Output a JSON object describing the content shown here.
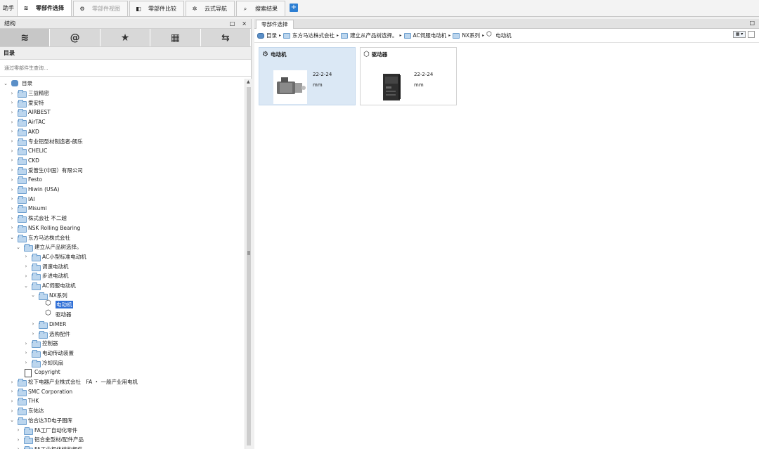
{
  "topbar": {
    "helper": "助手",
    "tabs": [
      {
        "label": "零部件选择",
        "icon": "database-icon",
        "active": true,
        "disabled": false
      },
      {
        "label": "零部件视图",
        "icon": "parts-view-icon",
        "active": false,
        "disabled": true
      },
      {
        "label": "零部件比较",
        "icon": "compare-icon",
        "active": false,
        "disabled": false
      },
      {
        "label": "云式导航",
        "icon": "cloud-nav-icon",
        "active": false,
        "disabled": false
      },
      {
        "label": "搜索结果",
        "icon": "search-icon",
        "active": false,
        "disabled": false
      }
    ],
    "add_label": "+"
  },
  "left": {
    "panel_title": "结构",
    "pin_icon": "□",
    "close_icon": "×",
    "icon_tabs": [
      {
        "name": "catalog-tab",
        "glyph": "≋"
      },
      {
        "name": "at-tab",
        "glyph": "@"
      },
      {
        "name": "favorites-tab",
        "glyph": "★"
      },
      {
        "name": "calendar-tab",
        "glyph": "▦"
      },
      {
        "name": "export-tab",
        "glyph": "⇆"
      }
    ],
    "section_title": "目录",
    "search_placeholder": "通过零部件生查询...",
    "tree": [
      {
        "label": "目录",
        "level": 0,
        "expanded": true,
        "icon": "db",
        "chev": "⌄"
      },
      {
        "label": "三益精密",
        "level": 1,
        "icon": "folder",
        "chev": "›"
      },
      {
        "label": "爱安特",
        "level": 1,
        "icon": "folder",
        "chev": "›"
      },
      {
        "label": "AIRBEST",
        "level": 1,
        "icon": "folder",
        "chev": "›"
      },
      {
        "label": "AirTAC",
        "level": 1,
        "icon": "folder",
        "chev": "›"
      },
      {
        "label": "AKD",
        "level": 1,
        "icon": "folder",
        "chev": "›"
      },
      {
        "label": "专业铝型材制造者-朗乐",
        "level": 1,
        "icon": "folder",
        "chev": "›"
      },
      {
        "label": "CHELIC",
        "level": 1,
        "icon": "folder",
        "chev": "›"
      },
      {
        "label": "CKD",
        "level": 1,
        "icon": "folder",
        "chev": "›"
      },
      {
        "label": "爱普生(中国）有限公司",
        "level": 1,
        "icon": "folder",
        "chev": "›"
      },
      {
        "label": "Festo",
        "level": 1,
        "icon": "folder",
        "chev": "›"
      },
      {
        "label": "Hiwin (USA)",
        "level": 1,
        "icon": "folder",
        "chev": "›"
      },
      {
        "label": "IAI",
        "level": 1,
        "icon": "folder",
        "chev": "›"
      },
      {
        "label": "Misumi",
        "level": 1,
        "icon": "folder",
        "chev": "›"
      },
      {
        "label": "株式会社 不二越",
        "level": 1,
        "icon": "folder",
        "chev": "›"
      },
      {
        "label": "NSK Rolling Bearing",
        "level": 1,
        "icon": "folder",
        "chev": "›"
      },
      {
        "label": "东方马达株式会社",
        "level": 1,
        "icon": "folder",
        "chev": "⌄"
      },
      {
        "label": "建立从产品树选择。",
        "level": 2,
        "icon": "folder",
        "chev": "⌄"
      },
      {
        "label": "AC小型标准电动机",
        "level": 3,
        "icon": "folder",
        "chev": "›"
      },
      {
        "label": "调速电动机",
        "level": 3,
        "icon": "folder",
        "chev": "›"
      },
      {
        "label": "步进电动机",
        "level": 3,
        "icon": "folder",
        "chev": "›"
      },
      {
        "label": "AC伺服电动机",
        "level": 3,
        "icon": "folder",
        "chev": "⌄"
      },
      {
        "label": "NX系列",
        "level": 4,
        "icon": "folder",
        "chev": "⌄"
      },
      {
        "label": "电动机",
        "level": 5,
        "icon": "cube",
        "chev": "",
        "selected": true
      },
      {
        "label": "驱动器",
        "level": 5,
        "icon": "cube",
        "chev": ""
      },
      {
        "label": "DiMER",
        "level": 4,
        "icon": "folder",
        "chev": "›"
      },
      {
        "label": "选购配件",
        "level": 4,
        "icon": "folder",
        "chev": "›"
      },
      {
        "label": "控制器",
        "level": 3,
        "icon": "folder",
        "chev": "›"
      },
      {
        "label": "电动传动装置",
        "level": 3,
        "icon": "folder",
        "chev": "›"
      },
      {
        "label": "冷却风扇",
        "level": 3,
        "icon": "folder",
        "chev": "›"
      },
      {
        "label": "Copyright",
        "level": 2,
        "icon": "doc",
        "chev": ""
      },
      {
        "label": "松下电器产业株式会社　FA ・ 一般产业用电机",
        "level": 1,
        "icon": "folder",
        "chev": "›"
      },
      {
        "label": "SMC Corporation",
        "level": 1,
        "icon": "folder",
        "chev": "›"
      },
      {
        "label": "THK",
        "level": 1,
        "icon": "folder",
        "chev": "›"
      },
      {
        "label": "东佑达",
        "level": 1,
        "icon": "folder",
        "chev": "›"
      },
      {
        "label": "怡合达3D电子图库",
        "level": 1,
        "icon": "folder",
        "chev": "⌄"
      },
      {
        "label": "FA工厂自动化零件",
        "level": 2,
        "icon": "folder",
        "chev": "›"
      },
      {
        "label": "铝合金型材/配件产品",
        "level": 2,
        "icon": "folder",
        "chev": "›"
      },
      {
        "label": "FA工业框体结构部件",
        "level": 2,
        "icon": "folder",
        "chev": "›"
      }
    ]
  },
  "right": {
    "tab_label": "零部件选择",
    "max_icon": "□",
    "breadcrumb": [
      {
        "label": "目录",
        "icon": "db"
      },
      {
        "label": "东方马达株式会社",
        "icon": "folder"
      },
      {
        "label": "建立从产品树选择。",
        "icon": "folder"
      },
      {
        "label": "AC伺服电动机",
        "icon": "folder"
      },
      {
        "label": "NX系列",
        "icon": "folder"
      },
      {
        "label": "电动机",
        "icon": "cube"
      }
    ],
    "cards": [
      {
        "title": "电动机",
        "icon": "motor-parts-icon",
        "date": "22-2-24",
        "unit": "mm",
        "selected": true
      },
      {
        "title": "驱动器",
        "icon": "cube-icon",
        "date": "22-2-24",
        "unit": "mm",
        "selected": false
      }
    ]
  }
}
